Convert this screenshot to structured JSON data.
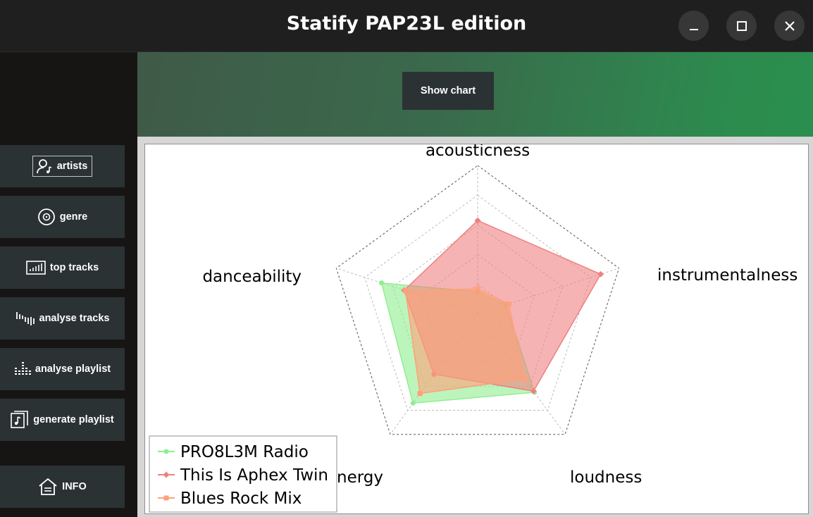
{
  "window": {
    "title": "Statify PAP23L edition",
    "controls": [
      "minimize-icon",
      "maximize-icon",
      "close-icon"
    ]
  },
  "sidebar": {
    "items": [
      {
        "label": "artists",
        "icon": "user-music-icon"
      },
      {
        "label": "genre",
        "icon": "disc-icon"
      },
      {
        "label": "top tracks",
        "icon": "bar-chart-icon"
      },
      {
        "label": "analyse tracks",
        "icon": "waveform-icon"
      },
      {
        "label": "analyse playlist",
        "icon": "equalizer-icon"
      },
      {
        "label": "generate playlist",
        "icon": "music-file-icon"
      }
    ],
    "info": {
      "label": "INFO",
      "icon": "home-icon"
    }
  },
  "header": {
    "show_chart_label": "Show chart"
  },
  "colors": {
    "accent_green": "#2a8f4e",
    "button_bg": "#2b3234",
    "series": [
      "#90ee90",
      "#f08080",
      "#ffa07a"
    ]
  },
  "chart_data": {
    "type": "radar",
    "axes": [
      "acousticness",
      "instrumentalness",
      "loudness",
      "energy",
      "danceability"
    ],
    "rmax": 1.0,
    "grid_levels": [
      0.2,
      0.4,
      0.6,
      0.8,
      1.0
    ],
    "grid": true,
    "legend_position": "bottom-left",
    "series": [
      {
        "name": "PRO8L3M Radio",
        "color": "#90ee90",
        "marker": "circle",
        "values": [
          0.15,
          0.2,
          0.65,
          0.74,
          0.68
        ]
      },
      {
        "name": "This Is Aphex Twin",
        "color": "#f08080",
        "marker": "diamond",
        "values": [
          0.63,
          0.87,
          0.64,
          0.5,
          0.52
        ]
      },
      {
        "name": "Blues Rock Mix",
        "color": "#ffa07a",
        "marker": "square",
        "values": [
          0.17,
          0.22,
          0.54,
          0.66,
          0.51
        ]
      }
    ]
  }
}
